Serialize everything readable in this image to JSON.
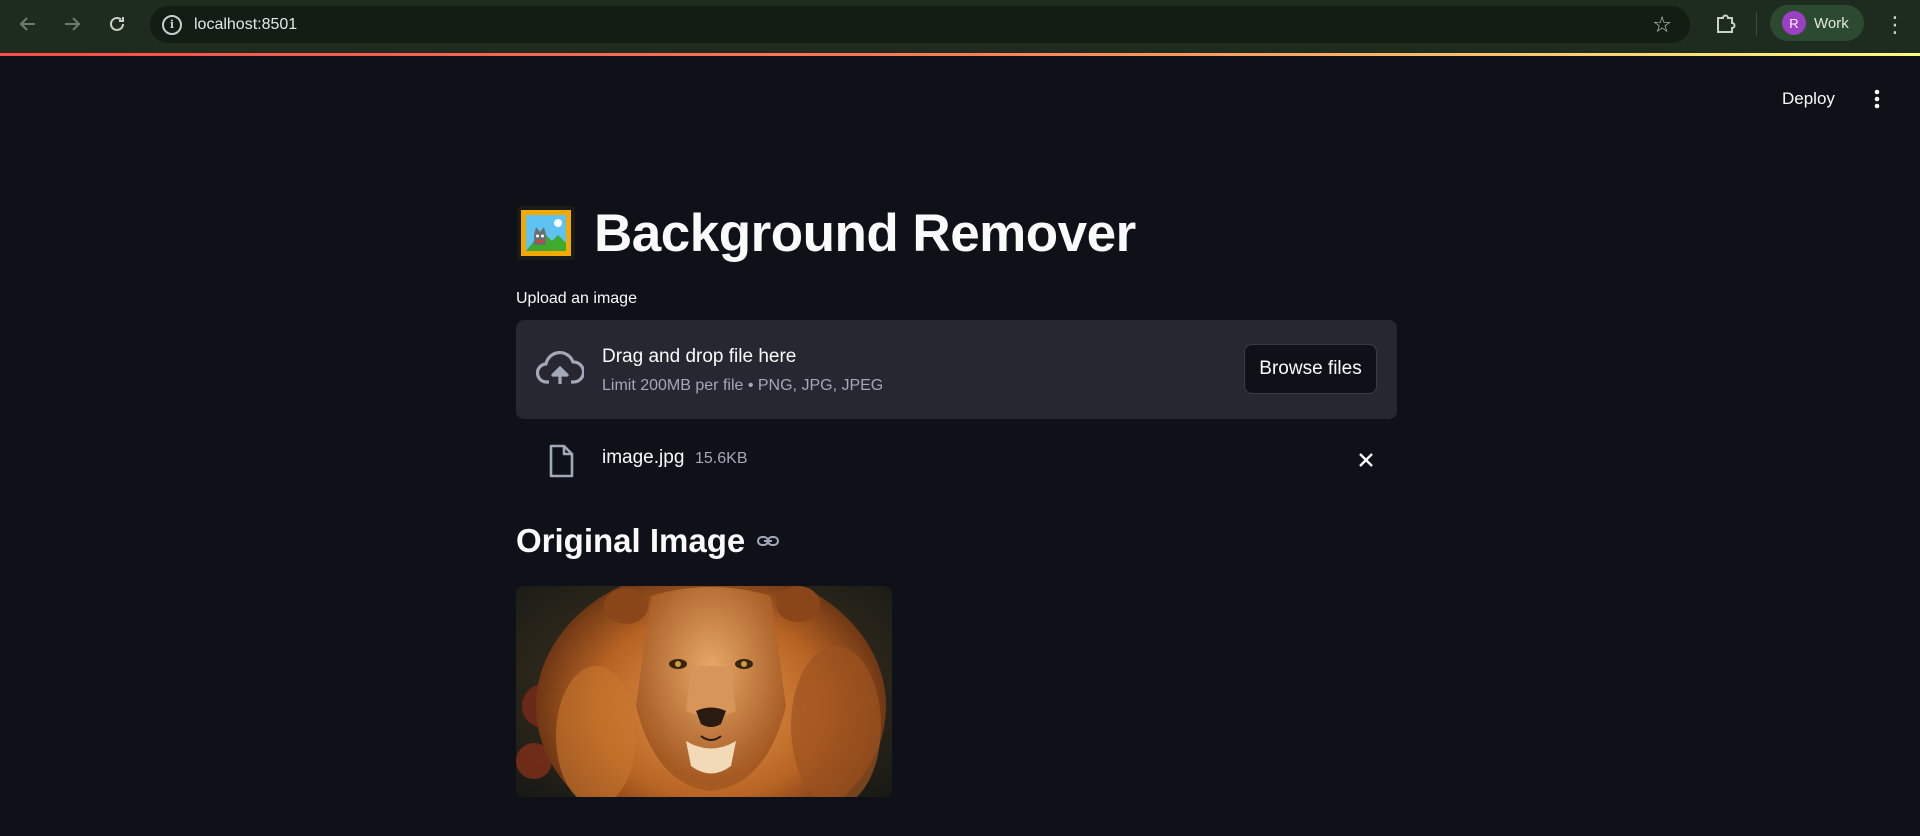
{
  "browser": {
    "url": "localhost:8501",
    "profile_initial": "R",
    "profile_name": "Work",
    "icons": [
      "back-arrow-icon",
      "forward-arrow-icon",
      "reload-icon",
      "site-info-icon",
      "bookmark-star-icon",
      "extensions-icon",
      "browser-menu-icon"
    ]
  },
  "app_header": {
    "deploy_label": "Deploy"
  },
  "page": {
    "title_emoji": "framed-picture-emoji",
    "title": "Background Remover",
    "uploader": {
      "label": "Upload an image",
      "drop_title": "Drag and drop file here",
      "limit_text": "Limit 200MB per file • PNG, JPG, JPEG",
      "browse_label": "Browse files"
    },
    "uploaded_file": {
      "name": "image.jpg",
      "size": "15.6KB"
    },
    "section_title": "Original Image",
    "image_description": "lion portrait"
  },
  "colors": {
    "background": "#0e1117",
    "surface": "#262730",
    "text": "#fafafa",
    "muted_text": "#a3a8b8",
    "browser_bar": "#1e2b1f",
    "accent_gradient": [
      "#ff4b4b",
      "#fffd80"
    ]
  }
}
